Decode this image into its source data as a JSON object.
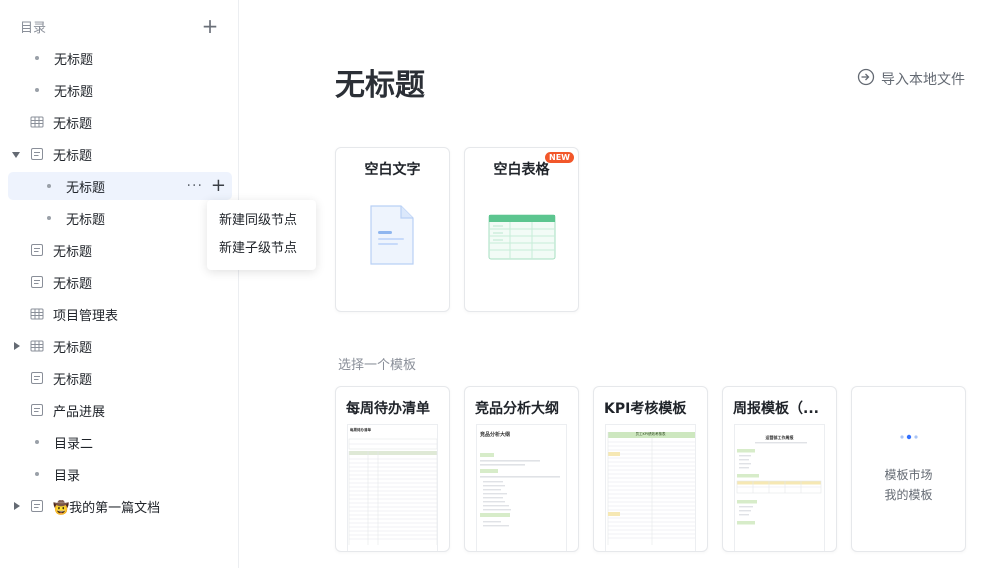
{
  "sidebar": {
    "title": "目录",
    "items": [
      {
        "label": "无标题",
        "icon": "bullet-dot"
      },
      {
        "label": "无标题",
        "icon": "bullet-dot"
      },
      {
        "label": "无标题",
        "icon": "table-icon"
      },
      {
        "label": "无标题",
        "icon": "doc-icon",
        "expanded": true
      },
      {
        "label": "无标题",
        "icon": "bullet-dot",
        "selected": true
      },
      {
        "label": "无标题",
        "icon": "bullet-dot"
      },
      {
        "label": "无标题",
        "icon": "doc-icon"
      },
      {
        "label": "无标题",
        "icon": "doc-icon"
      },
      {
        "label": "项目管理表",
        "icon": "table-icon"
      },
      {
        "label": "无标题",
        "icon": "table-icon",
        "collapsed": true
      },
      {
        "label": "无标题",
        "icon": "doc-icon"
      },
      {
        "label": "产品进展",
        "icon": "doc-icon"
      },
      {
        "label": "目录二",
        "icon": "bullet-dot"
      },
      {
        "label": "目录",
        "icon": "bullet-dot"
      },
      {
        "label": "🤠我的第一篇文档",
        "icon": "doc-icon",
        "collapsed": true
      }
    ],
    "row_actions": {
      "more": "···",
      "add": "+"
    },
    "context_menu": [
      "新建同级节点",
      "新建子级节点"
    ]
  },
  "main": {
    "title": "无标题",
    "import_label": "导入本地文件",
    "blank_cards": [
      {
        "label": "空白文字"
      },
      {
        "label": "空白表格",
        "badge": "NEW"
      }
    ],
    "templates_section_label": "选择一个模板",
    "templates": [
      {
        "title": "每周待办清单",
        "thumb_title": "每周待办清单"
      },
      {
        "title": "竞品分析大纲",
        "thumb_title": "竞品分析大纲"
      },
      {
        "title": "KPI考核模板",
        "thumb_title": "员工KPI绩效考核表"
      },
      {
        "title": "周报模板（...",
        "thumb_title": "运营部工作周报"
      }
    ],
    "more_card": {
      "line1": "模板市场",
      "line2": "我的模板"
    }
  },
  "colors": {
    "accent": "#3370ff",
    "badge": "#f2572a",
    "table_green": "#43b980",
    "selected_bg": "#eef3fd"
  }
}
